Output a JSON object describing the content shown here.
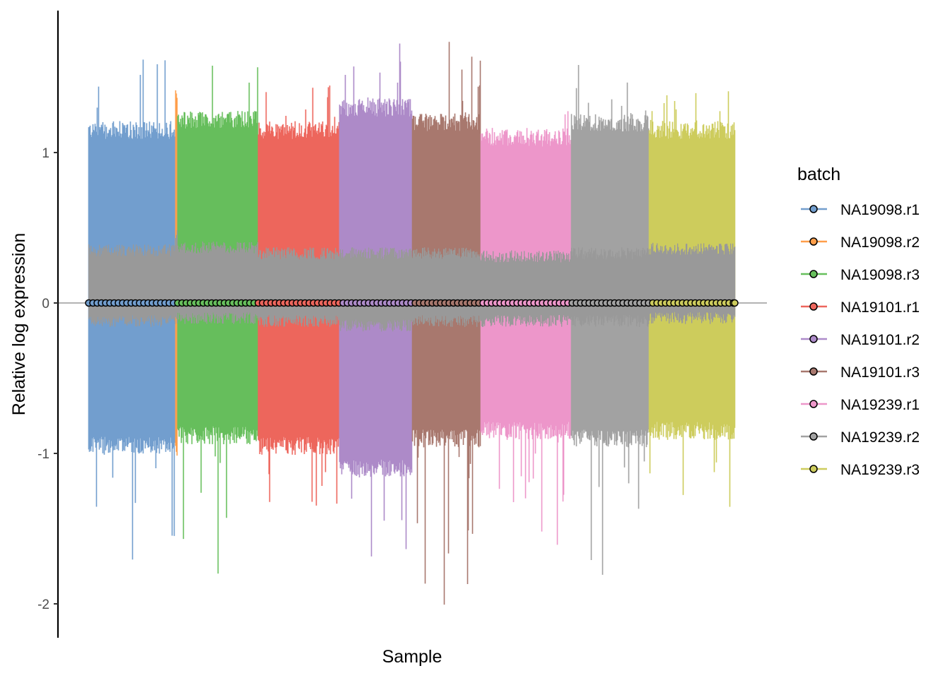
{
  "chart_data": {
    "type": "box",
    "title": "",
    "xlabel": "Sample",
    "ylabel": "Relative log expression",
    "ylim": [
      -2.35,
      1.95
    ],
    "yticks": [
      1,
      0,
      -1,
      -2
    ],
    "ytick_labels": [
      "1",
      "0",
      "-1",
      "-2"
    ],
    "reference_line": 0,
    "legend": {
      "title": "batch",
      "placement": "right"
    },
    "batches": [
      {
        "name": "NA19098.r1",
        "color": "#729ECE",
        "n_samples": 123,
        "median": 0,
        "q1": -0.12,
        "q3": 0.35,
        "whisker_low": -0.95,
        "whisker_high": 1.15,
        "min": -1.89,
        "max": 1.67
      },
      {
        "name": "NA19098.r2",
        "color": "#FF9E4A",
        "n_samples": 3,
        "median": 0,
        "q1": -0.1,
        "q3": 0.45,
        "whisker_low": -0.98,
        "whisker_high": 1.38,
        "min": -0.98,
        "max": 1.38
      },
      {
        "name": "NA19098.r3",
        "color": "#67BF5C",
        "n_samples": 114,
        "median": 0,
        "q1": -0.1,
        "q3": 0.37,
        "whisker_low": -0.88,
        "whisker_high": 1.22,
        "min": -1.84,
        "max": 1.62
      },
      {
        "name": "NA19101.r1",
        "color": "#ED665D",
        "n_samples": 115,
        "median": 0,
        "q1": -0.12,
        "q3": 0.33,
        "whisker_low": -0.95,
        "whisker_high": 1.15,
        "min": -1.45,
        "max": 1.45
      },
      {
        "name": "NA19101.r2",
        "color": "#AD8BC9",
        "n_samples": 103,
        "median": 0,
        "q1": -0.15,
        "q3": 0.33,
        "whisker_low": -1.1,
        "whisker_high": 1.3,
        "min": -1.85,
        "max": 1.73
      },
      {
        "name": "NA19101.r3",
        "color": "#A8786E",
        "n_samples": 97,
        "median": 0,
        "q1": -0.12,
        "q3": 0.33,
        "whisker_low": -0.9,
        "whisker_high": 1.2,
        "min": -2.04,
        "max": 1.76
      },
      {
        "name": "NA19239.r1",
        "color": "#ED97CA",
        "n_samples": 128,
        "median": 0,
        "q1": -0.12,
        "q3": 0.31,
        "whisker_low": -0.85,
        "whisker_high": 1.1,
        "min": -1.66,
        "max": 1.4
      },
      {
        "name": "NA19239.r2",
        "color": "#A2A2A2",
        "n_samples": 110,
        "median": 0,
        "q1": -0.12,
        "q3": 0.33,
        "whisker_low": -0.9,
        "whisker_high": 1.2,
        "min": -1.87,
        "max": 1.62
      },
      {
        "name": "NA19239.r3",
        "color": "#CDCC5D",
        "n_samples": 122,
        "median": 0,
        "q1": -0.1,
        "q3": 0.36,
        "whisker_low": -0.85,
        "whisker_high": 1.15,
        "min": -1.41,
        "max": 1.42
      }
    ],
    "box_color": "#999999",
    "median_color": "#000000"
  }
}
